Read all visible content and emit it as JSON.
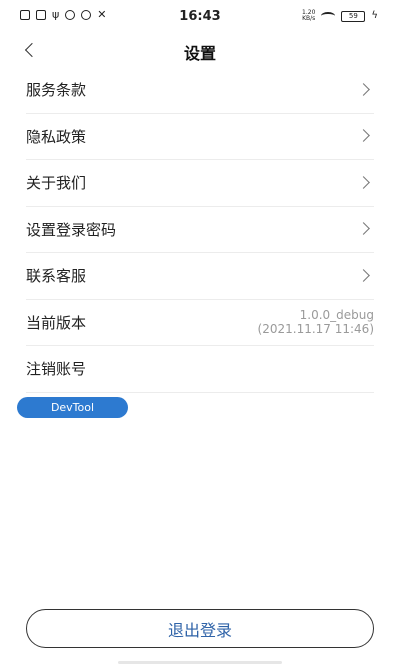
{
  "status_bar": {
    "time": "16:43",
    "left_icons": [
      "image-notification-icon",
      "mail-notification-icon",
      "usb-icon",
      "q-app-icon",
      "clock-icon",
      "tools-icon"
    ],
    "network_speed": "1.20",
    "network_speed_unit": "KB/s",
    "battery_level": "59"
  },
  "nav": {
    "title": "设置",
    "back_icon": "chevron-left-icon"
  },
  "menu": {
    "items": [
      {
        "label": "服务条款"
      },
      {
        "label": "隐私政策"
      },
      {
        "label": "关于我们"
      },
      {
        "label": "设置登录密码"
      },
      {
        "label": "联系客服"
      }
    ],
    "version": {
      "label": "当前版本",
      "value": "1.0.0_debug",
      "build_date": "(2021.11.17 11:46)"
    },
    "delete_account": {
      "label": "注销账号"
    }
  },
  "devtool": {
    "label": "DevTool",
    "color": "#2d7ad0"
  },
  "logout": {
    "label": "退出登录",
    "color": "#2f63a8"
  }
}
